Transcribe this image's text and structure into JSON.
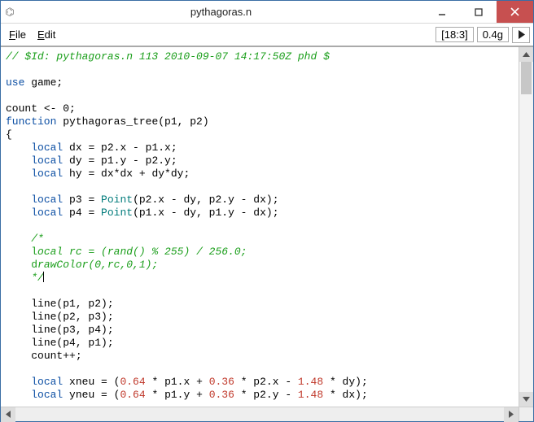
{
  "window": {
    "title": "pythagoras.n"
  },
  "menubar": {
    "file": "File",
    "edit": "Edit",
    "cursor_pos": "[18:3]",
    "mem": "0.4g"
  },
  "code": {
    "l1_c": "// $Id: pythagoras.n 113 2010-09-07 14:17:50Z phd $",
    "l2": "",
    "l3_kw": "use",
    "l3_rest": " game;",
    "l4": "",
    "l5_a": "count ",
    "l5_b": "<-",
    "l5_c": " 0;",
    "l6_kw": "function",
    "l6_rest": " pythagoras_tree(p1, p2)",
    "l7": "{",
    "l8_ind": "    ",
    "l8_kw": "local",
    "l8_rest": " dx = p2.x - p1.x;",
    "l9_ind": "    ",
    "l9_kw": "local",
    "l9_rest": " dy = p1.y - p2.y;",
    "l10_ind": "    ",
    "l10_kw": "local",
    "l10_rest": " hy = dx*dx + dy*dy;",
    "l11": "",
    "l12_ind": "    ",
    "l12_kw": "local",
    "l12_a": " p3 = ",
    "l12_ty": "Point",
    "l12_b": "(p2.x - dy, p2.y - dx);",
    "l13_ind": "    ",
    "l13_kw": "local",
    "l13_a": " p4 = ",
    "l13_ty": "Point",
    "l13_b": "(p1.x - dy, p1.y - dx);",
    "l14": "",
    "l15_ind": "    ",
    "l15": "/*",
    "l16_ind": "    ",
    "l16_cap": "l",
    "l16": "ocal rc = (rand() % 255) / 256.0;",
    "l17_ind": "    ",
    "l17_cap": "d",
    "l17": "rawColor(0,rc,0,1);",
    "l18_ind": "    ",
    "l18": "*/",
    "l19": "",
    "l20_ind": "    ",
    "l20": "line(p1, p2);",
    "l21_ind": "    ",
    "l21": "line(p2, p3);",
    "l22_ind": "    ",
    "l22": "line(p3, p4);",
    "l23_ind": "    ",
    "l23": "line(p4, p1);",
    "l24_ind": "    ",
    "l24": "count++;",
    "l25": "",
    "l26_ind": "    ",
    "l26_kw": "local",
    "l26_a": " xneu = (",
    "l26_n1": "0.64",
    "l26_b": " * p1.x + ",
    "l26_n2": "0.36",
    "l26_c": " * p2.x - ",
    "l26_n3": "1.48",
    "l26_d": " * dy);",
    "l27_ind": "    ",
    "l27_kw": "local",
    "l27_a": " yneu = (",
    "l27_n1": "0.64",
    "l27_b": " * p1.y + ",
    "l27_n2": "0.36",
    "l27_c": " * p2.y - ",
    "l27_n3": "1.48",
    "l27_d": " * dx);"
  }
}
